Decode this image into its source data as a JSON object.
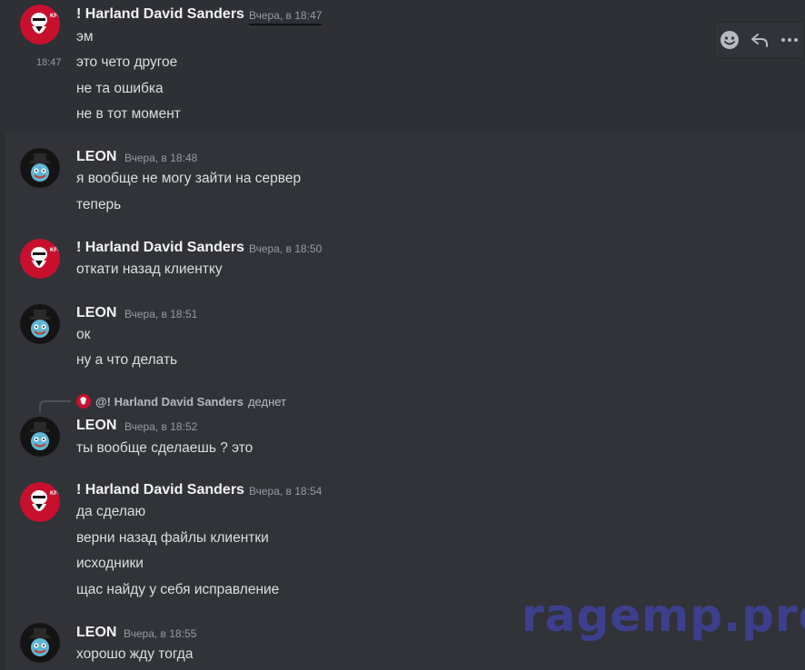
{
  "messages": [
    {
      "author": "! Harland David Sanders",
      "timestamp": "Вчера, в 18:47",
      "side_time": "18:47",
      "lines": [
        "эм",
        "это чето другое",
        "не та ошибка",
        "не в тот момент"
      ]
    },
    {
      "author": "LEON",
      "timestamp": "Вчера, в 18:48",
      "lines": [
        "я вообще не могу зайти на сервер",
        "теперь"
      ]
    },
    {
      "author": "! Harland David Sanders",
      "timestamp": "Вчера, в 18:50",
      "lines": [
        "откати назад клиентку"
      ]
    },
    {
      "author": "LEON",
      "timestamp": "Вчера, в 18:51",
      "lines": [
        "ок",
        "ну а что делать"
      ]
    },
    {
      "author": "LEON",
      "timestamp": "Вчера, в 18:52",
      "reply": {
        "author": "@! Harland David Sanders",
        "text": "деднет"
      },
      "lines": [
        "ты вообще сделаешь ? это"
      ]
    },
    {
      "author": "! Harland David Sanders",
      "timestamp": "Вчера, в 18:54",
      "lines": [
        "да сделаю",
        "верни назад файлы клиентки",
        "исходники",
        "щас найду у себя исправление"
      ]
    },
    {
      "author": "LEON",
      "timestamp": "Вчера, в 18:55",
      "lines": [
        "хорошо жду тогда"
      ]
    }
  ],
  "toolbar": {
    "icons": [
      "emoji-icon",
      "reply-icon",
      "more-icon"
    ]
  },
  "watermark": "ragemp.pro",
  "colors": {
    "background": "#313338",
    "text": "#dbdee1",
    "username": "#f2f3f5",
    "timestamp": "#949ba4",
    "kfc_red": "#c8102e"
  }
}
